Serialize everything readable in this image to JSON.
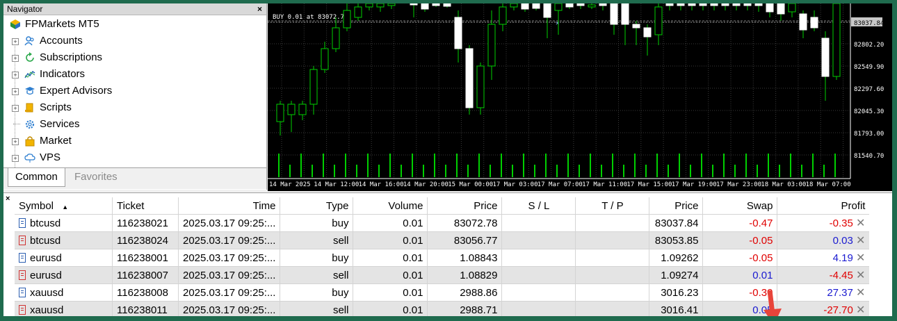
{
  "navigator": {
    "title": "Navigator",
    "close": "×",
    "root": "FPMarkets MT5",
    "items": [
      {
        "label": "Accounts",
        "icon": "accounts-icon"
      },
      {
        "label": "Subscriptions",
        "icon": "subscriptions-icon"
      },
      {
        "label": "Indicators",
        "icon": "indicators-icon"
      },
      {
        "label": "Expert Advisors",
        "icon": "expert-advisors-icon"
      },
      {
        "label": "Scripts",
        "icon": "scripts-icon"
      },
      {
        "label": "Services",
        "icon": "services-icon"
      },
      {
        "label": "Market",
        "icon": "market-icon"
      },
      {
        "label": "VPS",
        "icon": "vps-icon"
      }
    ],
    "tabs": {
      "common": "Common",
      "favorites": "Favorites"
    }
  },
  "chart": {
    "trade_label": "BUY 0.01 at 83072.78",
    "price_levels": [
      "83037.84",
      "82802.20",
      "82549.90",
      "82297.60",
      "82045.30",
      "81793.00",
      "81540.70"
    ],
    "current_price": "83037.84",
    "time_labels": [
      "14 Mar 2025",
      "14 Mar 12:00",
      "14 Mar 16:00",
      "14 Mar 20:00",
      "15 Mar 00:00",
      "17 Mar 03:00",
      "17 Mar 07:00",
      "17 Mar 11:00",
      "17 Mar 15:00",
      "17 Mar 19:00",
      "17 Mar 23:00",
      "18 Mar 03:00",
      "18 Mar 07:00"
    ],
    "colors": {
      "bull": "#00d000",
      "bear": "#ffffff",
      "background": "#000000"
    }
  },
  "toolbox": {
    "close": "×",
    "columns": [
      "Symbol",
      "Ticket",
      "Time",
      "Type",
      "Volume",
      "Price",
      "S / L",
      "T / P",
      "Price",
      "Swap",
      "Profit"
    ],
    "sort_indicator": "▲",
    "rows": [
      {
        "symbol": "btcusd",
        "ticket": "116238021",
        "time": "2025.03.17 09:25:...",
        "type": "buy",
        "volume": "0.01",
        "open_price": "83072.78",
        "sl": "",
        "tp": "",
        "price": "83037.84",
        "swap": "-0.47",
        "profit": "-0.35"
      },
      {
        "symbol": "btcusd",
        "ticket": "116238024",
        "time": "2025.03.17 09:25:...",
        "type": "sell",
        "volume": "0.01",
        "open_price": "83056.77",
        "sl": "",
        "tp": "",
        "price": "83053.85",
        "swap": "-0.05",
        "profit": "0.03"
      },
      {
        "symbol": "eurusd",
        "ticket": "116238001",
        "time": "2025.03.17 09:25:...",
        "type": "buy",
        "volume": "0.01",
        "open_price": "1.08843",
        "sl": "",
        "tp": "",
        "price": "1.09262",
        "swap": "-0.05",
        "profit": "4.19"
      },
      {
        "symbol": "eurusd",
        "ticket": "116238007",
        "time": "2025.03.17 09:25:...",
        "type": "sell",
        "volume": "0.01",
        "open_price": "1.08829",
        "sl": "",
        "tp": "",
        "price": "1.09274",
        "swap": "0.01",
        "profit": "-4.45"
      },
      {
        "symbol": "xauusd",
        "ticket": "116238008",
        "time": "2025.03.17 09:25:...",
        "type": "buy",
        "volume": "0.01",
        "open_price": "2988.86",
        "sl": "",
        "tp": "",
        "price": "3016.23",
        "swap": "-0.30",
        "profit": "27.37"
      },
      {
        "symbol": "xauusd",
        "ticket": "116238011",
        "time": "2025.03.17 09:25:...",
        "type": "sell",
        "volume": "0.01",
        "open_price": "2988.71",
        "sl": "",
        "tp": "",
        "price": "3016.41",
        "swap": "0.05",
        "profit": "-27.70"
      }
    ],
    "close_icon": "✕"
  },
  "colors": {
    "frame": "#1f6b4e",
    "negative": "#e00000",
    "positive": "#1a1ad0",
    "arrow": "#e8443a"
  }
}
